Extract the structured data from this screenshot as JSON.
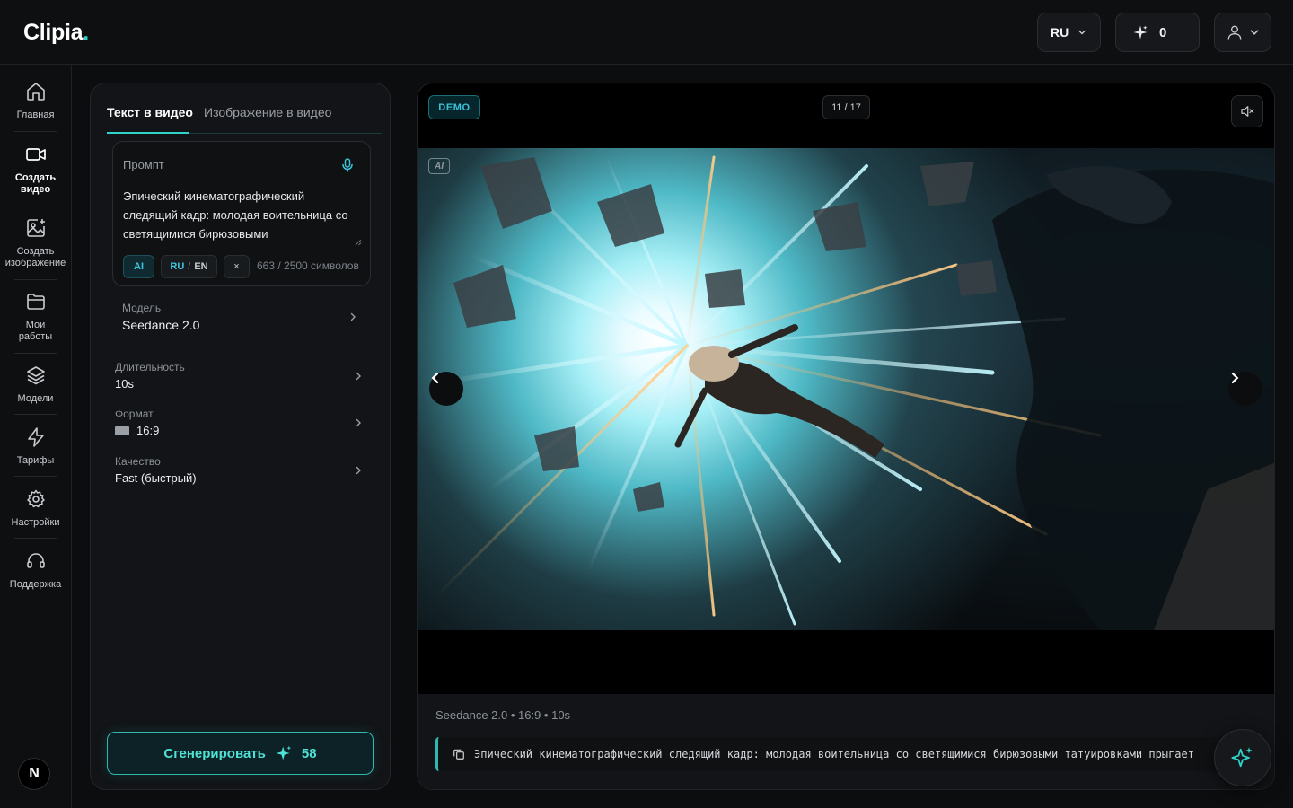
{
  "app": {
    "logo_text": "Clipia",
    "logo_dot": "."
  },
  "header": {
    "language": "RU",
    "credits": "0"
  },
  "rail": {
    "home": "Главная",
    "create_video": "Создать видео",
    "create_image": "Создать изображение",
    "my_works": "Мои работы",
    "models": "Модели",
    "pricing": "Тарифы",
    "settings": "Настройки",
    "support": "Поддержка",
    "avatar_letter": "N"
  },
  "panel": {
    "tabs": [
      {
        "label": "Текст в видео",
        "active": true
      },
      {
        "label": "Изображение в видео",
        "active": false
      }
    ],
    "prompt": {
      "label": "Промпт",
      "text": "Эпический кинематографический следящий кадр: молодая воительница со светящимися бирюзовыми",
      "chip_ai": "AI",
      "chip_lang_ru": "RU",
      "chip_lang_sep": "/",
      "chip_lang_en": "EN",
      "chip_clear": "×",
      "char_count": "663 / 2500 символов"
    },
    "settings": {
      "model": {
        "label": "Модель",
        "value": "Seedance 2.0"
      },
      "duration": {
        "label": "Длительность",
        "value": "10s"
      },
      "format": {
        "label": "Формат",
        "value": "16:9"
      },
      "quality": {
        "label": "Качество",
        "value": "Fast (быстрый)"
      }
    },
    "generate": {
      "label": "Сгенерировать",
      "cost": "58"
    }
  },
  "preview": {
    "demo_badge": "DEMO",
    "counter": "11 / 17",
    "ai_tag": "AI",
    "meta": "Seedance 2.0 • 16:9 • 10s",
    "prompt_full": "Эпический кинематографический следящий кадр: молодая воительница со светящимися бирюзовыми татуировками прыгает"
  },
  "colors": {
    "accent": "#2fd3c8",
    "accent_dark": "#0d2226",
    "bg": "#0c0d0f",
    "panel": "#121417"
  }
}
